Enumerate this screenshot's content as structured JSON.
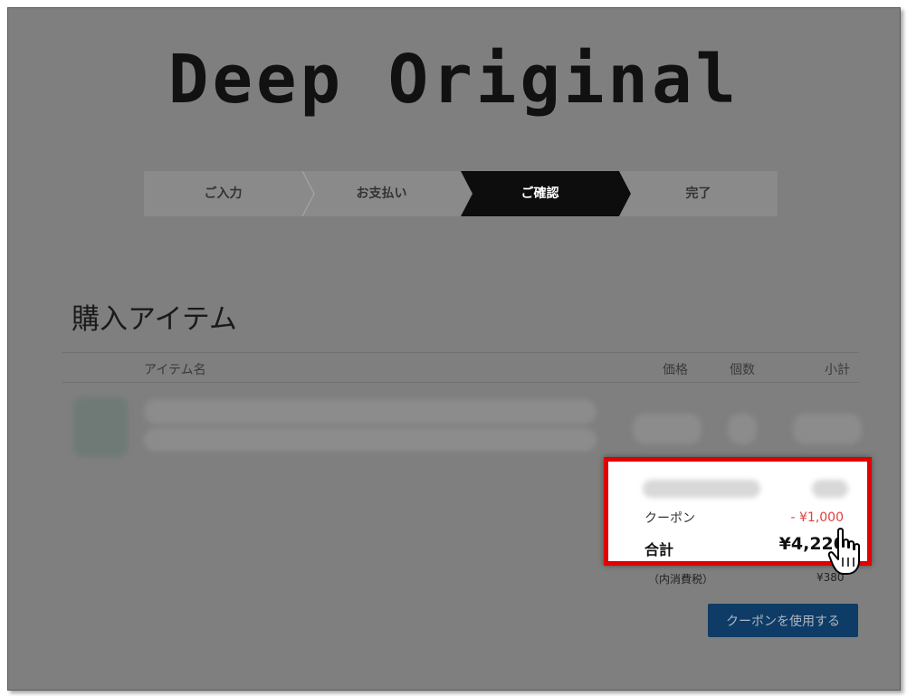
{
  "brand": {
    "logo_text": "Deep Original"
  },
  "steps": [
    {
      "label": "ご入力",
      "active": false
    },
    {
      "label": "お支払い",
      "active": false
    },
    {
      "label": "ご確認",
      "active": true
    },
    {
      "label": "完了",
      "active": false
    }
  ],
  "section": {
    "title": "購入アイテム"
  },
  "table": {
    "headers": {
      "item_name": "アイテム名",
      "price": "価格",
      "quantity": "個数",
      "subtotal": "小計"
    }
  },
  "summary": {
    "coupon_label": "クーポン",
    "coupon_value": "- ¥1,000",
    "total_label": "合計",
    "total_value": "¥4,220",
    "tax_label": "（内消費税）",
    "tax_value": "¥380"
  },
  "actions": {
    "use_coupon_label": "クーポンを使用する"
  },
  "colors": {
    "overlay": "#7f7f7f",
    "accent_red": "#e00000",
    "button_blue": "#0e3c66",
    "coupon_red": "#e04040"
  }
}
